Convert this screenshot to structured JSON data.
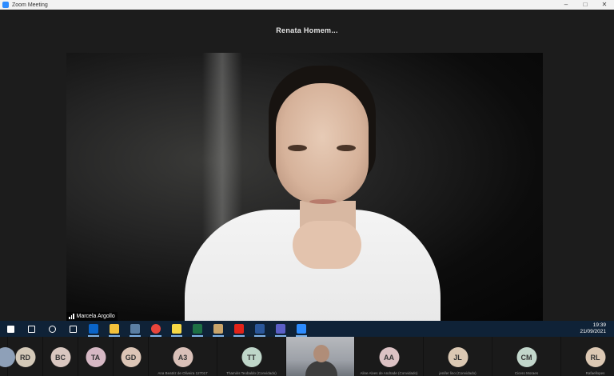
{
  "window": {
    "title": "Zoom Meeting",
    "controls": [
      "–",
      "□",
      "✕"
    ]
  },
  "speaker": {
    "name": "Renata  Homem..."
  },
  "video": {
    "participant_name": "Marcela Argollo"
  },
  "taskbar": {
    "items": [
      {
        "name": "windows-start-icon",
        "color": "#ffffff"
      },
      {
        "name": "search-icon",
        "color": "#ffffff"
      },
      {
        "name": "cortana-icon",
        "color": "#ffffff"
      },
      {
        "name": "task-view-icon",
        "color": "#ffffff"
      },
      {
        "name": "outlook-icon",
        "color": "#0a64c8"
      },
      {
        "name": "file-explorer-icon",
        "color": "#f3c13b"
      },
      {
        "name": "calculator-icon",
        "color": "#5b7fa3"
      },
      {
        "name": "chrome-icon",
        "color": "#e8453c"
      },
      {
        "name": "sticky-notes-icon",
        "color": "#f6d845"
      },
      {
        "name": "excel-icon",
        "color": "#1e7145"
      },
      {
        "name": "paint-icon",
        "color": "#c9a46a"
      },
      {
        "name": "acrobat-icon",
        "color": "#e2231a"
      },
      {
        "name": "word-icon",
        "color": "#2b579a"
      },
      {
        "name": "teams-icon",
        "color": "#5b5fc7"
      },
      {
        "name": "zoom-icon",
        "color": "#2d8cff"
      }
    ],
    "time": "19:39",
    "date": "21/09/2021"
  },
  "participants": [
    {
      "initials": "",
      "name": "",
      "color": "#8ea0b8",
      "partial": true
    },
    {
      "initials": "RD",
      "name": "",
      "color": "#d4c9b8"
    },
    {
      "initials": "BC",
      "name": "",
      "color": "#d9c7c0"
    },
    {
      "initials": "TA",
      "name": "",
      "color": "#d6b8c4"
    },
    {
      "initials": "GD",
      "name": "",
      "color": "#dcc5b6"
    },
    {
      "initials": "A3",
      "name": "Ana Beatriz de Oliveira 127017",
      "color": "#d9c0b8",
      "wide": true
    },
    {
      "initials": "TT",
      "name": "Thamiris Teobaldo (Convidado)",
      "color": "#bfd6c9",
      "wide": true
    },
    {
      "initials": "",
      "name": "",
      "video": true,
      "wide": true
    },
    {
      "initials": "AA",
      "name": "Aline Alves de Andrade (Convidado)",
      "color": "#dcc2c4",
      "wide": true
    },
    {
      "initials": "JL",
      "name": "jenifer lino (Convidado)",
      "color": "#dbc8b3",
      "wide": true
    },
    {
      "initials": "CM",
      "name": "Cicero Moraes",
      "color": "#c2d6cb",
      "wide": true
    },
    {
      "initials": "RL",
      "name": "Rafaellopes",
      "color": "#dcc8b3",
      "wide": true
    }
  ]
}
